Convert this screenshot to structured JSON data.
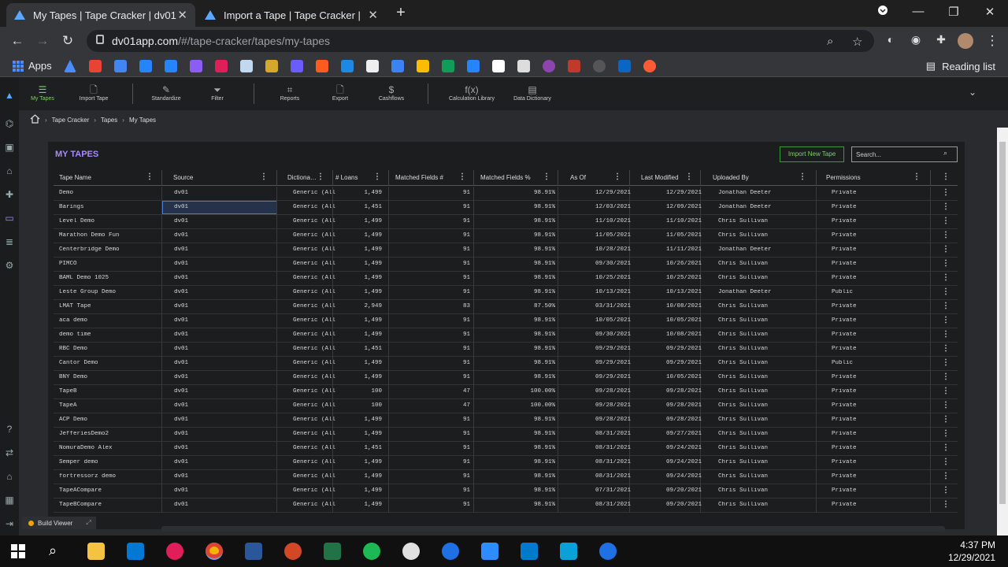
{
  "browser": {
    "tabs": [
      {
        "title": "My Tapes | Tape Cracker | dv01",
        "close": "✕"
      },
      {
        "title": "Import a Tape | Tape Cracker | dv",
        "close": "✕"
      }
    ],
    "new_tab": "+",
    "url_host": "dv01app.com",
    "url_path": "/#/tape-cracker/tapes/my-tapes",
    "apps_label": "Apps",
    "reading_list": "Reading list"
  },
  "toolbar": {
    "items": [
      {
        "label": "My Tapes",
        "icon": "☰"
      },
      {
        "label": "Import Tape",
        "icon": "🗋"
      },
      {
        "label": "Standardize",
        "icon": "✎"
      },
      {
        "label": "Filter",
        "icon": "⏷"
      },
      {
        "label": "Reports",
        "icon": "⌗"
      },
      {
        "label": "Export",
        "icon": "🗋"
      },
      {
        "label": "Cashflows",
        "icon": "$"
      },
      {
        "label": "Calculation Library",
        "icon": "f(x)"
      },
      {
        "label": "Data Dictionary",
        "icon": "▤"
      }
    ],
    "collapse_icon": "⌄"
  },
  "breadcrumb": [
    "Tape Cracker",
    "Tapes",
    "My Tapes"
  ],
  "panel": {
    "title": "MY TAPES",
    "import_button": "Import New Tape",
    "search_placeholder": "Search..."
  },
  "table": {
    "columns": [
      "Tape Name",
      "Source",
      "Dictiona…",
      "# Loans",
      "Matched Fields #",
      "Matched Fields %",
      "As Of",
      "Last Modified",
      "Uploaded By",
      "Permissions"
    ],
    "rows": [
      [
        "Demo",
        "dv01",
        "Generic (All",
        "1,499",
        "91",
        "98.91%",
        "12/29/2021",
        "12/29/2021",
        "Jonathan Deeter",
        "Private"
      ],
      [
        "Barings",
        "dv01",
        "Generic (All",
        "1,451",
        "91",
        "98.91%",
        "12/03/2021",
        "12/09/2021",
        "Jonathan Deeter",
        "Private"
      ],
      [
        "Level Demo",
        "dv01",
        "Generic (All",
        "1,499",
        "91",
        "98.91%",
        "11/10/2021",
        "11/10/2021",
        "Chris Sullivan",
        "Private"
      ],
      [
        "Marathon Demo Fun",
        "dv01",
        "Generic (All",
        "1,499",
        "91",
        "98.91%",
        "11/05/2021",
        "11/05/2021",
        "Chris Sullivan",
        "Private"
      ],
      [
        "Centerbridge Demo",
        "dv01",
        "Generic (All",
        "1,499",
        "91",
        "98.91%",
        "10/28/2021",
        "11/11/2021",
        "Jonathan Deeter",
        "Private"
      ],
      [
        "PIMCO",
        "dv01",
        "Generic (All",
        "1,499",
        "91",
        "98.91%",
        "09/30/2021",
        "10/26/2021",
        "Chris Sullivan",
        "Private"
      ],
      [
        "BAML Demo 1025",
        "dv01",
        "Generic (All",
        "1,499",
        "91",
        "98.91%",
        "10/25/2021",
        "10/25/2021",
        "Chris Sullivan",
        "Private"
      ],
      [
        "Leste Group Demo",
        "dv01",
        "Generic (All",
        "1,499",
        "91",
        "98.91%",
        "10/13/2021",
        "10/13/2021",
        "Jonathan Deeter",
        "Public"
      ],
      [
        "LMAT Tape",
        "dv01",
        "Generic (All",
        "2,949",
        "83",
        "87.50%",
        "03/31/2021",
        "10/08/2021",
        "Chris Sullivan",
        "Private"
      ],
      [
        "aca demo",
        "dv01",
        "Generic (All",
        "1,499",
        "91",
        "98.91%",
        "10/05/2021",
        "10/05/2021",
        "Chris Sullivan",
        "Private"
      ],
      [
        "demo time",
        "dv01",
        "Generic (All",
        "1,499",
        "91",
        "98.91%",
        "09/30/2021",
        "10/08/2021",
        "Chris Sullivan",
        "Private"
      ],
      [
        "RBC Demo",
        "dv01",
        "Generic (All",
        "1,451",
        "91",
        "98.91%",
        "09/29/2021",
        "09/29/2021",
        "Chris Sullivan",
        "Private"
      ],
      [
        "Cantor Demo",
        "dv01",
        "Generic (All",
        "1,499",
        "91",
        "98.91%",
        "09/29/2021",
        "09/29/2021",
        "Chris Sullivan",
        "Public"
      ],
      [
        "BNY Demo",
        "dv01",
        "Generic (All",
        "1,499",
        "91",
        "98.91%",
        "09/29/2021",
        "10/05/2021",
        "Chris Sullivan",
        "Private"
      ],
      [
        "TapeB",
        "dv01",
        "Generic (All",
        "100",
        "47",
        "100.00%",
        "09/28/2021",
        "09/28/2021",
        "Chris Sullivan",
        "Private"
      ],
      [
        "TapeA",
        "dv01",
        "Generic (All",
        "100",
        "47",
        "100.00%",
        "09/28/2021",
        "09/28/2021",
        "Chris Sullivan",
        "Private"
      ],
      [
        "ACP Demo",
        "dv01",
        "Generic (All",
        "1,499",
        "91",
        "98.91%",
        "09/28/2021",
        "09/28/2021",
        "Chris Sullivan",
        "Private"
      ],
      [
        "JefferiesDemo2",
        "dv01",
        "Generic (All",
        "1,499",
        "91",
        "98.91%",
        "08/31/2021",
        "09/27/2021",
        "Chris Sullivan",
        "Private"
      ],
      [
        "NomuraDemo Alex",
        "dv01",
        "Generic (All",
        "1,451",
        "91",
        "98.91%",
        "08/31/2021",
        "09/24/2021",
        "Chris Sullivan",
        "Private"
      ],
      [
        "Semper demo",
        "dv01",
        "Generic (All",
        "1,499",
        "91",
        "98.91%",
        "08/31/2021",
        "09/24/2021",
        "Chris Sullivan",
        "Private"
      ],
      [
        "fortressorz demo",
        "dv01",
        "Generic (All",
        "1,499",
        "91",
        "98.91%",
        "08/31/2021",
        "09/24/2021",
        "Chris Sullivan",
        "Private"
      ],
      [
        "TapeACompare",
        "dv01",
        "Generic (All",
        "1,499",
        "91",
        "98.91%",
        "07/31/2021",
        "09/20/2021",
        "Chris Sullivan",
        "Private"
      ],
      [
        "TapeBCompare",
        "dv01",
        "Generic (All",
        "1,499",
        "91",
        "98.91%",
        "08/31/2021",
        "09/20/2021",
        "Chris Sullivan",
        "Private"
      ]
    ],
    "menu_icon": "⋮"
  },
  "build_viewer": "Build Viewer",
  "taskbar": {
    "time": "4:37 PM",
    "date": "12/29/2021"
  },
  "colors": {
    "accent_purple": "#a78bfa",
    "accent_green": "#7fcf6a",
    "panel_bg": "#1c1d1f"
  }
}
